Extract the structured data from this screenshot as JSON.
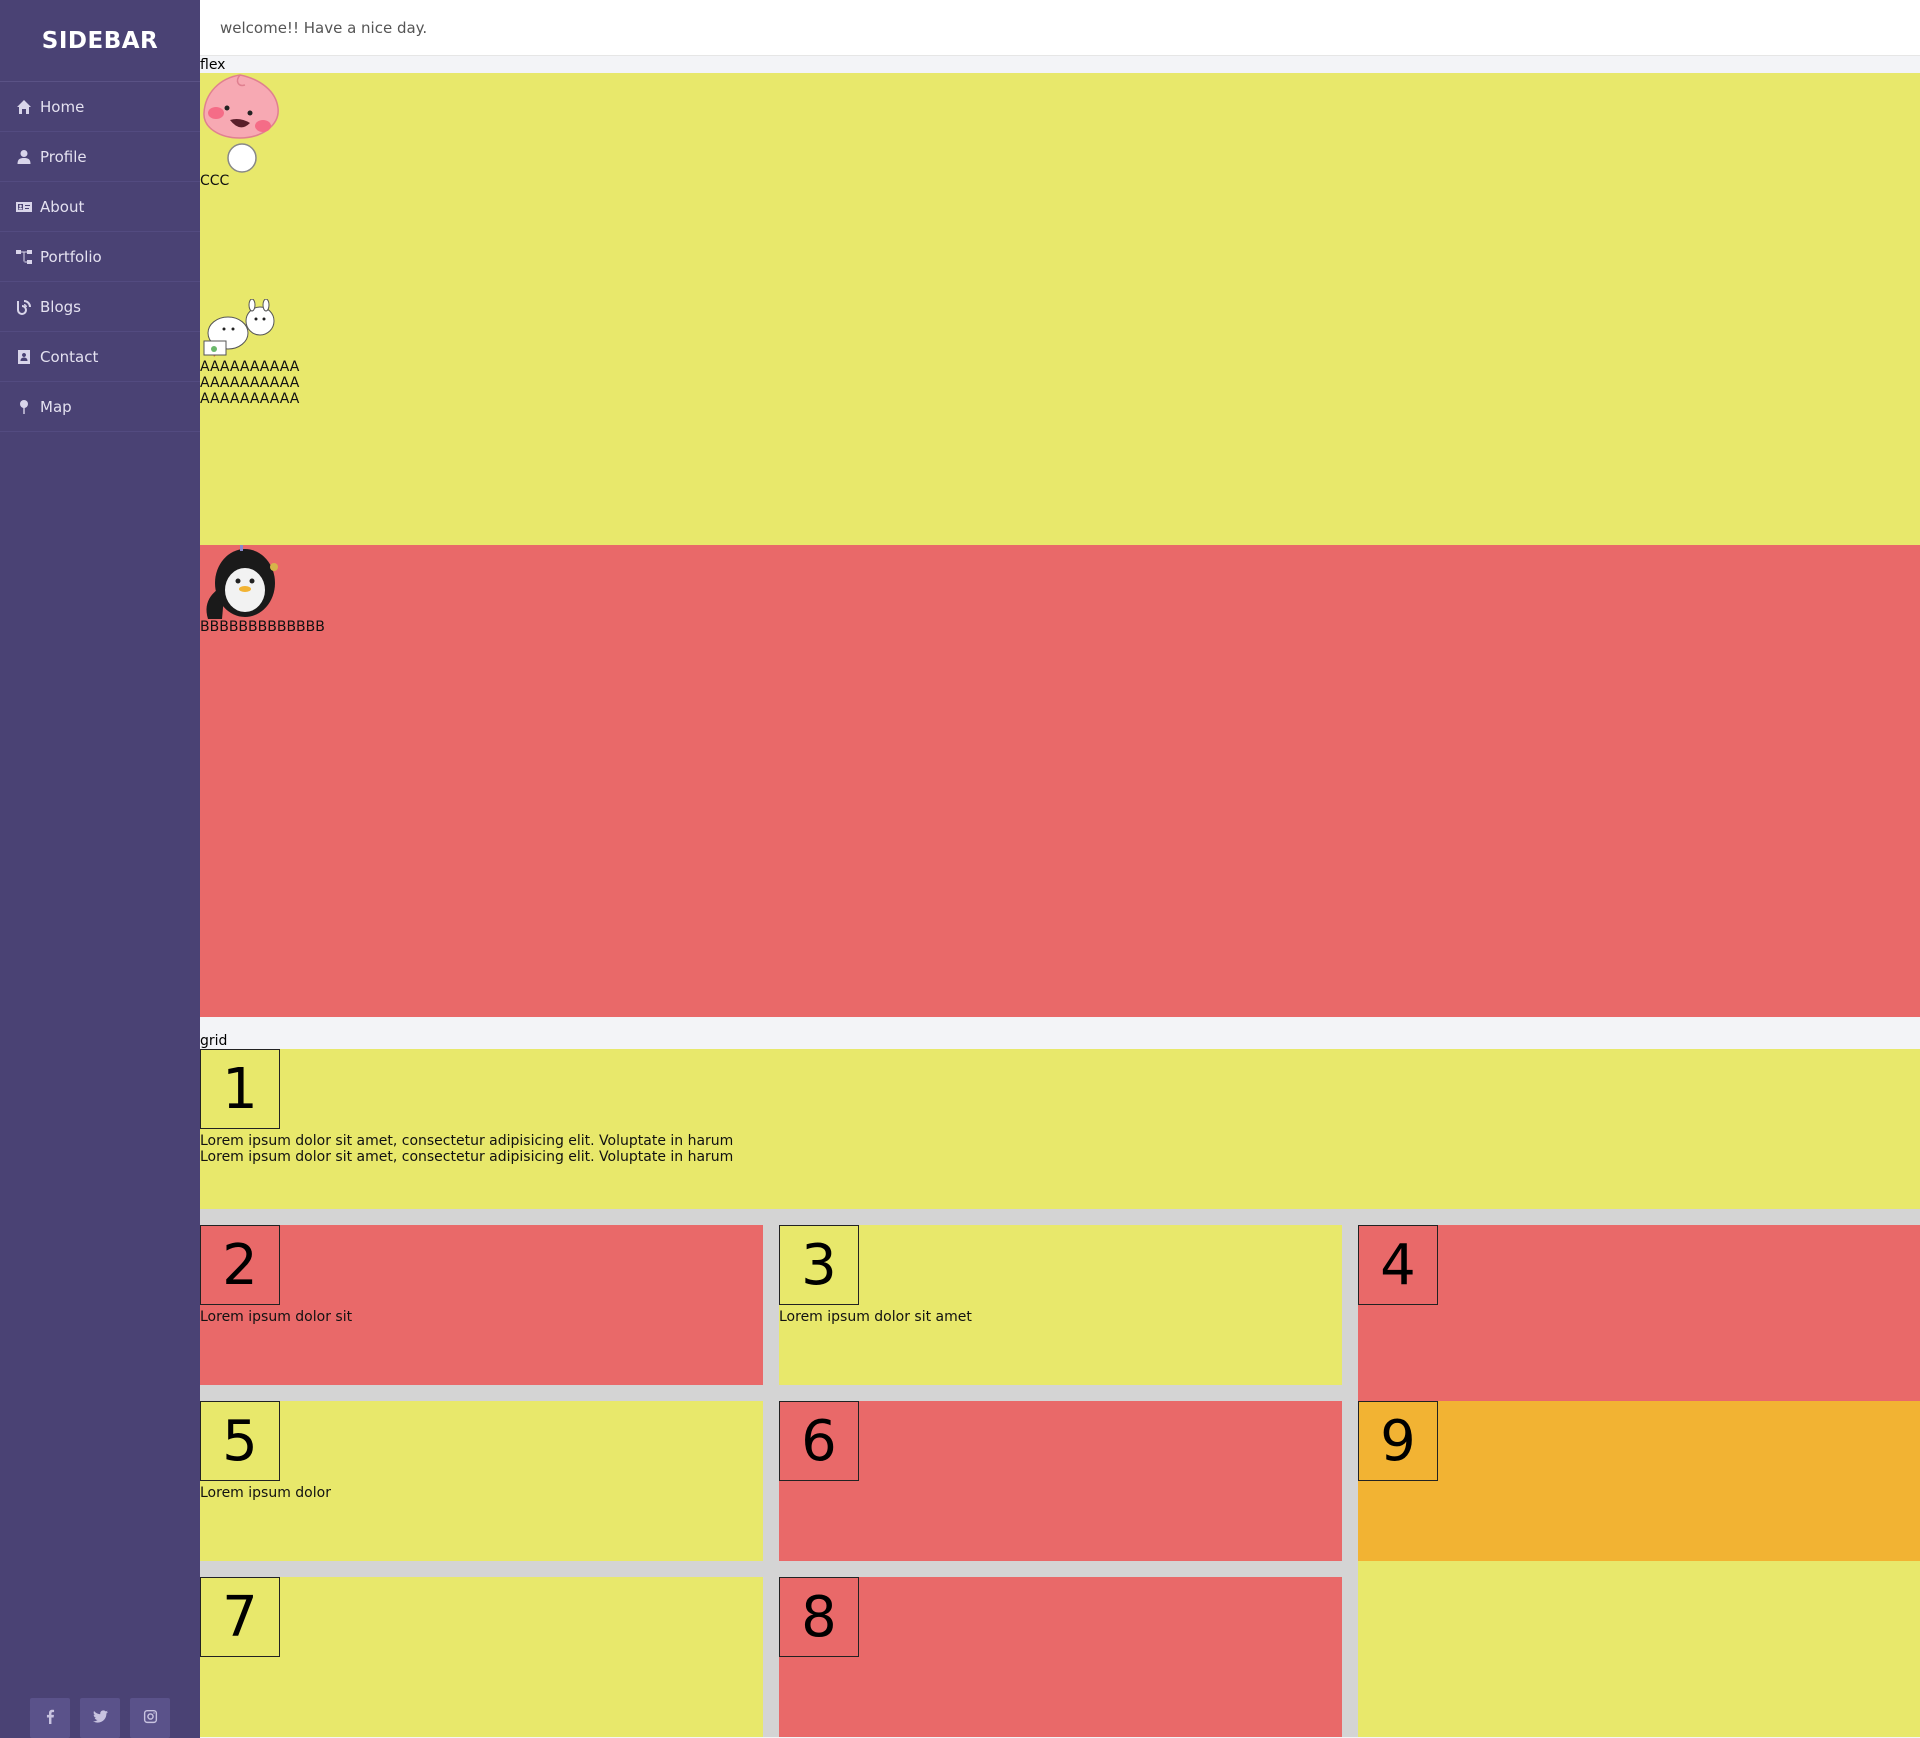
{
  "sidebar": {
    "brand": "SIDEBAR",
    "items": [
      {
        "label": "Home",
        "icon": "home-icon"
      },
      {
        "label": "Profile",
        "icon": "user-icon"
      },
      {
        "label": "About",
        "icon": "id-card-icon"
      },
      {
        "label": "Portfolio",
        "icon": "sitemap-icon"
      },
      {
        "label": "Blogs",
        "icon": "blog-icon"
      },
      {
        "label": "Contact",
        "icon": "address-book-icon"
      },
      {
        "label": "Map",
        "icon": "map-pin-icon"
      }
    ],
    "socials": [
      "facebook-icon",
      "twitter-icon",
      "instagram-icon"
    ]
  },
  "topbar": {
    "greeting": "welcome!! Have a nice day."
  },
  "flex": {
    "label": "flex",
    "item1_text": "CCC",
    "item2_lines": [
      "AAAAAAAAAA",
      "AAAAAAAAAA",
      "AAAAAAAAAA"
    ],
    "item3_text": "BBBBBBBBBBBBB"
  },
  "grid": {
    "label": "grid",
    "cells": [
      {
        "num": "1",
        "text": [
          "Lorem ipsum dolor sit amet, consectetur adipisicing elit. Voluptate in harum",
          "Lorem ipsum dolor sit amet, consectetur adipisicing elit. Voluptate in harum"
        ]
      },
      {
        "num": "2",
        "text": [
          "Lorem ipsum dolor sit"
        ]
      },
      {
        "num": "3",
        "text": [
          "Lorem ipsum dolor sit amet"
        ]
      },
      {
        "num": "4",
        "text": []
      },
      {
        "num": "5",
        "text": [
          "Lorem ipsum dolor"
        ]
      },
      {
        "num": "6",
        "text": []
      },
      {
        "num": "9",
        "text": []
      },
      {
        "num": "7",
        "text": []
      },
      {
        "num": "8",
        "text": []
      }
    ]
  },
  "colors": {
    "sidebar": "#4a4274",
    "yellow": "#e8e86b",
    "red": "#e96969",
    "orange": "#f2b333",
    "gutter": "#d4d4d4"
  }
}
